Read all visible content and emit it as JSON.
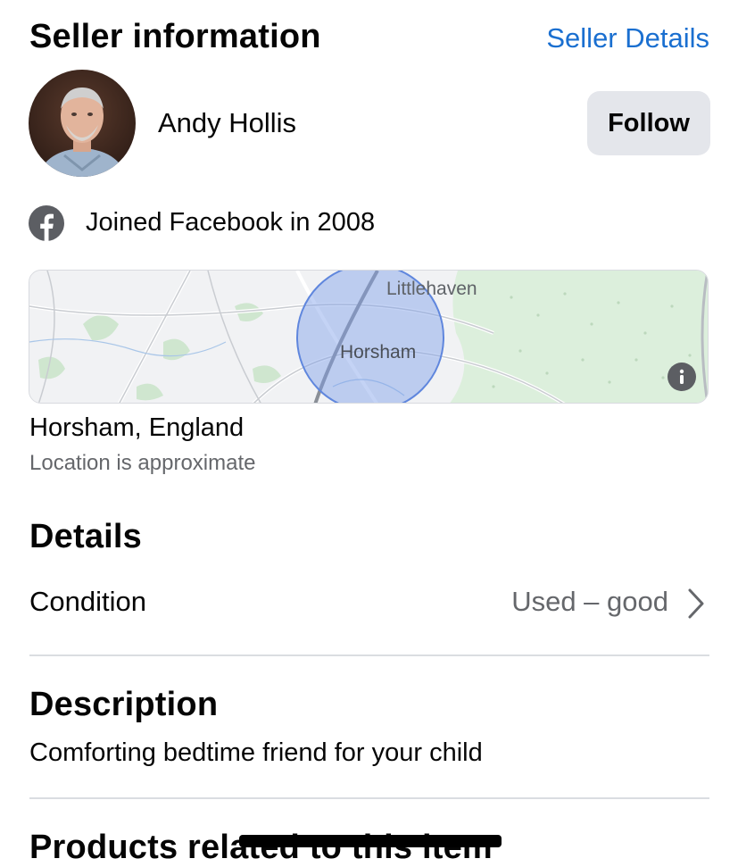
{
  "seller_section": {
    "title": "Seller information",
    "details_link": "Seller Details",
    "name": "Andy Hollis",
    "follow_label": "Follow",
    "joined_text": "Joined Facebook in 2008"
  },
  "map": {
    "labels": [
      "Littlehaven",
      "Horsham"
    ],
    "info_icon": "info-icon"
  },
  "location": {
    "place": "Horsham, England",
    "note": "Location is approximate"
  },
  "details": {
    "title": "Details",
    "condition_label": "Condition",
    "condition_value": "Used – good"
  },
  "description": {
    "title": "Description",
    "text": "Comforting bedtime friend for your child"
  },
  "related": {
    "title": "Products related to this item"
  },
  "colors": {
    "link": "#1a6fd0",
    "button_bg": "#e4e6eb",
    "secondary_text": "#65676b",
    "map_circle": "#7c9ee8"
  }
}
